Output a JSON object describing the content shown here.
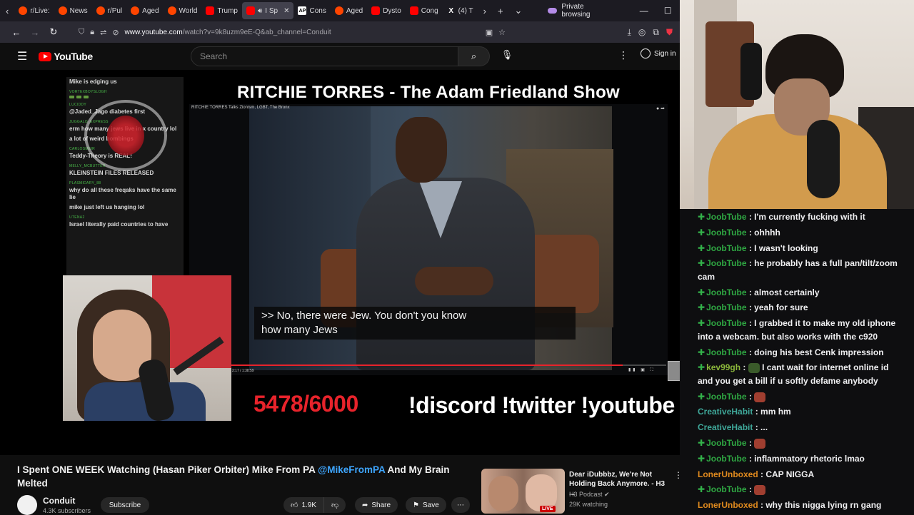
{
  "browser": {
    "tabs": [
      {
        "label": "r/Live:",
        "icon": "reddit-icon"
      },
      {
        "label": "News",
        "icon": "reddit-icon"
      },
      {
        "label": "r/Pul",
        "icon": "reddit-icon"
      },
      {
        "label": "Aged",
        "icon": "reddit-icon"
      },
      {
        "label": "World",
        "icon": "reddit-icon"
      },
      {
        "label": "Trump",
        "icon": "youtube-icon"
      },
      {
        "label": "I Sp",
        "icon": "youtube-icon",
        "active": true
      },
      {
        "label": "Cons",
        "icon": "ap-icon"
      },
      {
        "label": "Aged",
        "icon": "reddit-icon"
      },
      {
        "label": "Dysto",
        "icon": "youtube-icon"
      },
      {
        "label": "Cong",
        "icon": "youtube-icon"
      },
      {
        "label": "(4) T",
        "icon": "x-icon"
      }
    ],
    "private_label": "Private browsing",
    "url_host": "www.youtube.com",
    "url_rest": "/watch?v=9k8uzm9eE-Q&ab_channel=Conduit"
  },
  "youtube": {
    "logo_text": "YouTube",
    "search_placeholder": "Search",
    "signin_label": "Sign in"
  },
  "video": {
    "show_title": "RITCHIE TORRES - The Adam Friedland Show",
    "inner_caption_title": "RITCHIE TORRES Talks Zionism, LGBT, The Bronx",
    "subtitle_line1": ">> No, there were Jew. You don't you know",
    "subtitle_line2": "how many Jews",
    "inner_time": "2:17 / 1:38:59",
    "inner_progress": 0.9,
    "counter": "5478/6000",
    "socials": "!discord !twitter !youtube",
    "overlay_chat": [
      {
        "user": "",
        "msg": "Mike is edging us"
      },
      {
        "user": "VORTEXBOYSLOGH",
        "msg": "",
        "emotes": 3
      },
      {
        "user": "LUCIDDY",
        "msg": "@Jaded_Jago diabetes first"
      },
      {
        "user": "JUGGALO_EXPRESS",
        "msg": "erm how many jews live in x country lol"
      },
      {
        "user": "",
        "msg": "a lot of weird bombings"
      },
      {
        "user": "CARLOSMEIR",
        "msg": "Teddy-Theory is REAL!"
      },
      {
        "user": "MELLY_MCBUTTER",
        "msg": "KLEINSTEIN FILES RELEASED"
      },
      {
        "user": "PLASMIDARY_88",
        "msg": "why do all these freqaks have the same lie"
      },
      {
        "user": "",
        "msg": "mike just left us hanging lol"
      },
      {
        "user": "UTENA2",
        "msg": "Israel literally paid countries to have"
      }
    ]
  },
  "below": {
    "title_part1": "I Spent ONE WEEK Watching (Hasan Piker Orbiter) Mike From PA ",
    "title_link": "@MikeFromPA",
    "title_part2": " And My Brain Melted",
    "channel_name": "Conduit",
    "channel_subs": "4.3K subscribers",
    "subscribe_label": "Subscribe",
    "like_count": "1.9K",
    "share_label": "Share",
    "save_label": "Save"
  },
  "recommendation": {
    "title": "Dear iDubbbz, We're Not Holding Back Anymore. - H3 ...",
    "channel": "H3 Podcast",
    "watching": "29K watching",
    "live_badge": "LIVE"
  },
  "stream_chat": [
    {
      "user": "JoobTube",
      "color": "green",
      "badge": true,
      "text": "I'm currently fucking with it"
    },
    {
      "user": "JoobTube",
      "color": "green",
      "badge": true,
      "text": "ohhhh"
    },
    {
      "user": "JoobTube",
      "color": "green",
      "badge": true,
      "text": "I wasn't looking"
    },
    {
      "user": "JoobTube",
      "color": "green",
      "badge": true,
      "text": "he probably has a full pan/tilt/zoom cam"
    },
    {
      "user": "JoobTube",
      "color": "green",
      "badge": true,
      "text": "almost certainly"
    },
    {
      "user": "JoobTube",
      "color": "green",
      "badge": true,
      "text": "yeah for sure"
    },
    {
      "user": "JoobTube",
      "color": "green",
      "badge": true,
      "text": "I grabbed it to make my old iphone into a webcam. but also works with the c920"
    },
    {
      "user": "JoobTube",
      "color": "green",
      "badge": true,
      "text": "doing his best Cenk impression"
    },
    {
      "user": "kev99gh",
      "color": "olive",
      "badge": true,
      "emote": "frog",
      "text": "I cant wait for internet online id and you get a bill if u softly defame anybody"
    },
    {
      "user": "JoobTube",
      "color": "green",
      "badge": true,
      "emote": "red",
      "text": ""
    },
    {
      "user": "CreativeHabit",
      "color": "teal",
      "badge": false,
      "text": "mm hm"
    },
    {
      "user": "CreativeHabit",
      "color": "teal",
      "badge": false,
      "text": "..."
    },
    {
      "user": "JoobTube",
      "color": "green",
      "badge": true,
      "emote": "red",
      "text": ""
    },
    {
      "user": "JoobTube",
      "color": "green",
      "badge": true,
      "text": "inflammatory rhetoric lmao"
    },
    {
      "user": "LonerUnboxed",
      "color": "orange",
      "badge": false,
      "text": "CAP NIGGA"
    },
    {
      "user": "JoobTube",
      "color": "green",
      "badge": true,
      "emote": "red",
      "text": ""
    },
    {
      "user": "LonerUnboxed",
      "color": "orange",
      "badge": false,
      "text": "why this nigga lying rn gang"
    }
  ]
}
